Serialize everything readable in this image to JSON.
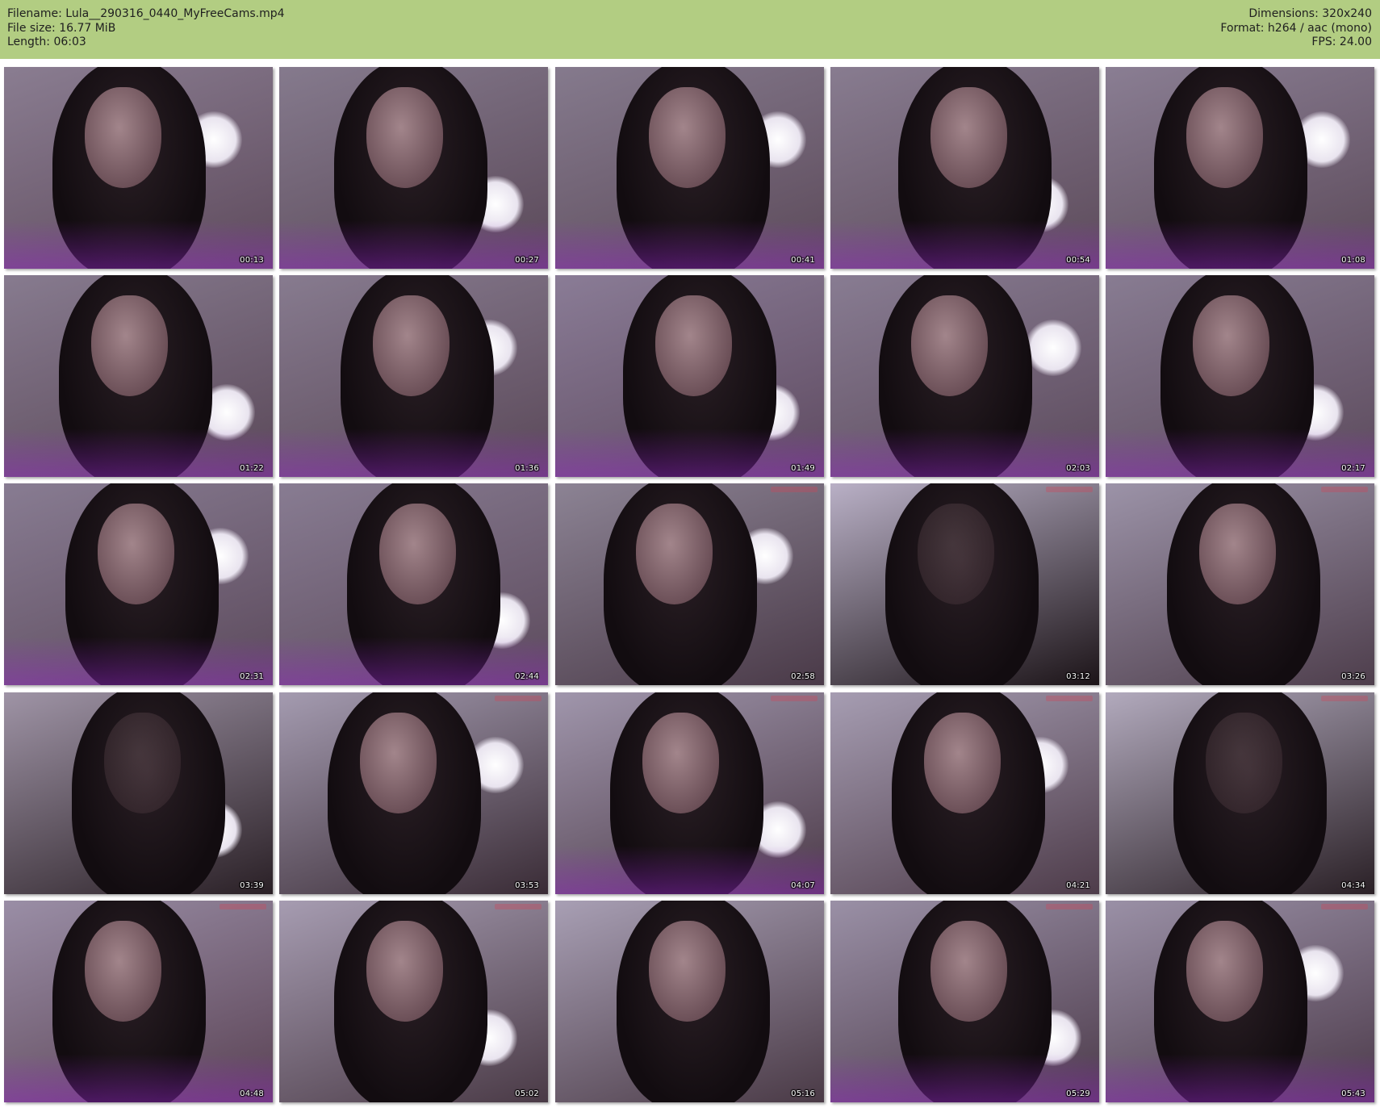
{
  "info": {
    "filename": "Filename: Lula__290316_0440_MyFreeCams.mp4",
    "filesize": "File size: 16.77 MiB",
    "length": "Length: 06:03",
    "dimensions": "Dimensions: 320x240",
    "format": "Format: h264 / aac (mono)",
    "fps": "FPS: 24.00"
  },
  "colors": {
    "header_bg": "#b2cd82",
    "page_bg": "#ffffff"
  },
  "thumbnails": [
    {
      "time": "00:13",
      "tint": "#5e4a5c",
      "bg": "#8a7d91",
      "light": true,
      "glow": true,
      "mark": false
    },
    {
      "time": "00:27",
      "tint": "#5a4858",
      "bg": "#857a8d",
      "light": true,
      "glow": true,
      "mark": false
    },
    {
      "time": "00:41",
      "tint": "#5c4a5a",
      "bg": "#857a8d",
      "light": true,
      "glow": true,
      "mark": false
    },
    {
      "time": "00:54",
      "tint": "#5c4a5a",
      "bg": "#887c90",
      "light": true,
      "glow": true,
      "mark": false
    },
    {
      "time": "01:08",
      "tint": "#5c4a5a",
      "bg": "#8a7e93",
      "light": true,
      "glow": true,
      "mark": false
    },
    {
      "time": "01:22",
      "tint": "#5a4858",
      "bg": "#877b8f",
      "light": true,
      "glow": true,
      "mark": false
    },
    {
      "time": "01:36",
      "tint": "#5a4858",
      "bg": "#877b8f",
      "light": true,
      "glow": true,
      "mark": false
    },
    {
      "time": "01:49",
      "tint": "#5e4a60",
      "bg": "#8a7c96",
      "light": true,
      "glow": true,
      "mark": false
    },
    {
      "time": "02:03",
      "tint": "#5c4a5c",
      "bg": "#887c92",
      "light": true,
      "glow": true,
      "mark": false
    },
    {
      "time": "02:17",
      "tint": "#5c4a5c",
      "bg": "#887c92",
      "light": true,
      "glow": true,
      "mark": false
    },
    {
      "time": "02:31",
      "tint": "#5c4a5c",
      "bg": "#887c92",
      "light": true,
      "glow": true,
      "mark": false
    },
    {
      "time": "02:44",
      "tint": "#5c4a5c",
      "bg": "#887c92",
      "light": true,
      "glow": true,
      "mark": false
    },
    {
      "time": "02:58",
      "tint": "#4a3a48",
      "bg": "#8c8394",
      "light": true,
      "glow": false,
      "mark": true
    },
    {
      "time": "03:12",
      "tint": "#1c1418",
      "bg": "#b9b0c6",
      "light": false,
      "glow": false,
      "mark": true
    },
    {
      "time": "03:26",
      "tint": "#4e3e4c",
      "bg": "#9c93a8",
      "light": false,
      "glow": false,
      "mark": true
    },
    {
      "time": "03:39",
      "tint": "#2a2026",
      "bg": "#9f94a6",
      "light": true,
      "glow": false,
      "mark": false
    },
    {
      "time": "03:53",
      "tint": "#3a2c36",
      "bg": "#a49bb0",
      "light": true,
      "glow": false,
      "mark": true
    },
    {
      "time": "04:07",
      "tint": "#4c3a48",
      "bg": "#a096ac",
      "light": true,
      "glow": true,
      "mark": true
    },
    {
      "time": "04:21",
      "tint": "#4e3c4a",
      "bg": "#a69db2",
      "light": true,
      "glow": false,
      "mark": true
    },
    {
      "time": "04:34",
      "tint": "#2a2026",
      "bg": "#b2aabd",
      "light": false,
      "glow": false,
      "mark": true
    },
    {
      "time": "04:48",
      "tint": "#5a4254",
      "bg": "#9a8ea6",
      "light": false,
      "glow": true,
      "mark": true
    },
    {
      "time": "05:02",
      "tint": "#4a3a46",
      "bg": "#a69cb1",
      "light": true,
      "glow": false,
      "mark": true
    },
    {
      "time": "05:16",
      "tint": "#4a3a46",
      "bg": "#a89fb4",
      "light": false,
      "glow": false,
      "mark": false
    },
    {
      "time": "05:29",
      "tint": "#4c3a4a",
      "bg": "#9a90a6",
      "light": true,
      "glow": true,
      "mark": true
    },
    {
      "time": "05:43",
      "tint": "#4c3a4a",
      "bg": "#9a90a6",
      "light": true,
      "glow": true,
      "mark": true
    }
  ]
}
